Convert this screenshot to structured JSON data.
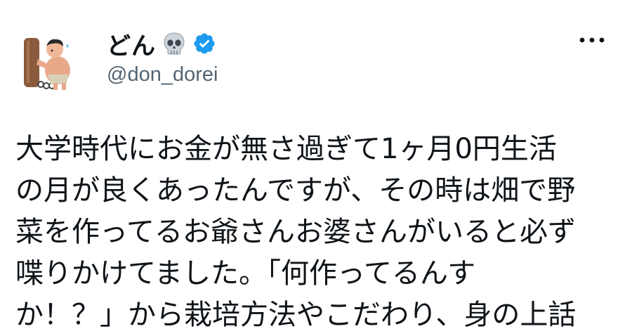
{
  "author": {
    "display_name": "どん",
    "handle": "@don_dorei",
    "verified": true
  },
  "icons": {
    "name_emoji": "skull-icon",
    "badge": "verified-badge-icon",
    "menu": "more-options-icon"
  },
  "colors": {
    "verified_blue": "#1d9bf0",
    "handle_gray": "#536471",
    "text": "#0f1419"
  },
  "tweet": {
    "lines": [
      "大学時代にお金が無さ過ぎて1ヶ月0円生活",
      "の月が良くあったんですが、その時は畑で野",
      "菜を作ってるお爺さんお婆さんがいると必ず",
      "喋りかけてました。「何作ってるんす",
      "か！？」から栽培方法やこだわり、身の上話"
    ]
  }
}
